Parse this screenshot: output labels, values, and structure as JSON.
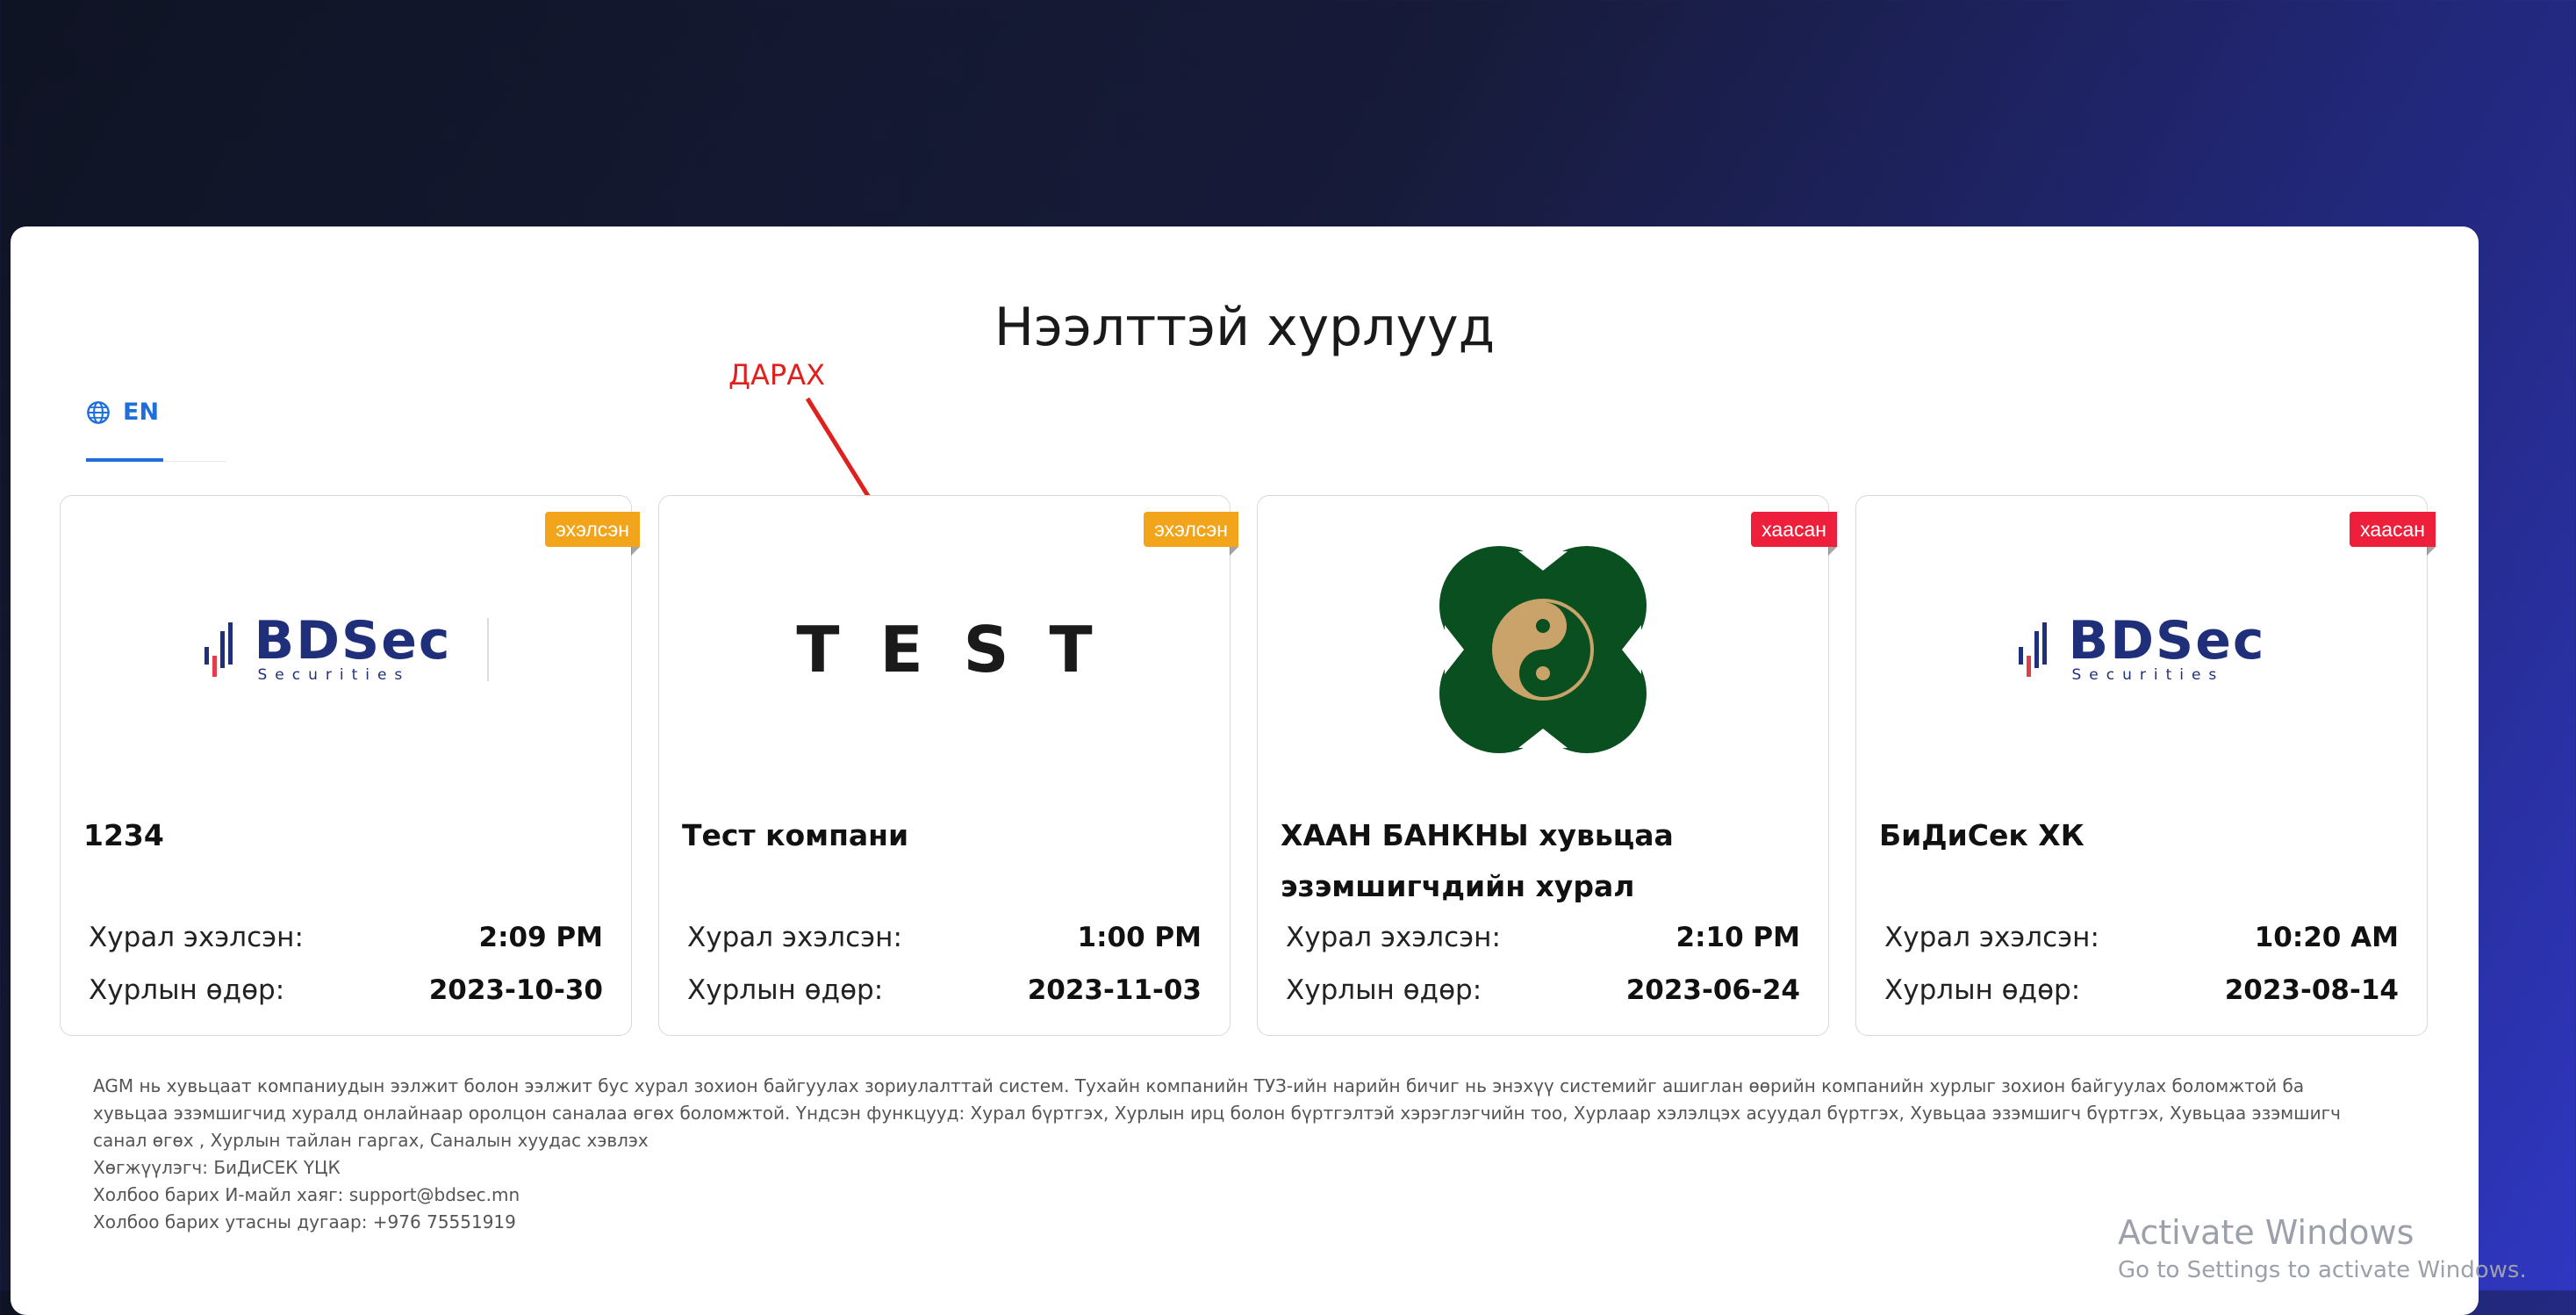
{
  "page": {
    "title": "Нээлттэй хурлууд"
  },
  "language_tab": {
    "label": "EN"
  },
  "annotation": {
    "label": "ДАРАХ",
    "color": "#e0201c"
  },
  "meetings": [
    {
      "status": "эхэлсэн",
      "status_color": "#f2a41a",
      "logo": "BDSec Securities logo",
      "logo_main": "BDSec",
      "logo_sub": "Securities",
      "company": "1234",
      "start_label": "Хурал эхэлсэн:",
      "start_time": "2:09 PM",
      "date_label": "Хурлын өдөр:",
      "date": "2023-10-30"
    },
    {
      "status": "эхэлсэн",
      "status_color": "#f2a41a",
      "logo": "TEST logo",
      "logo_text": "TEST",
      "company": "Тест компани",
      "start_label": "Хурал эхэлсэн:",
      "start_time": "1:00 PM",
      "date_label": "Хурлын өдөр:",
      "date": "2023-11-03"
    },
    {
      "status": "хаасан",
      "status_color": "#ee1f3a",
      "logo": "Khan Bank logo",
      "company": "ХААН БАНКНЫ хувьцаа эзэмшигчдийн хурал",
      "start_label": "Хурал эхэлсэн:",
      "start_time": "2:10 PM",
      "date_label": "Хурлын өдөр:",
      "date": "2023-06-24"
    },
    {
      "status": "хаасан",
      "status_color": "#ee1f3a",
      "logo": "BDSec Securities logo",
      "logo_main": "BDSec",
      "logo_sub": "Securities",
      "company": "БиДиСек ХК",
      "start_label": "Хурал эхэлсэн:",
      "start_time": "10:20 AM",
      "date_label": "Хурлын өдөр:",
      "date": "2023-08-14"
    }
  ],
  "footer": {
    "description": "AGM нь хувьцаат компаниудын ээлжит болон ээлжит бус хурал зохион байгуулах зориулалттай систем. Тухайн компанийн ТУЗ-ийн нарийн бичиг нь энэхүү системийг ашиглан өөрийн компанийн хурлыг зохион байгуулах боломжтой ба хувьцаа эзэмшигчид хуралд онлайнаар оролцон саналаа өгөх боломжтой. Үндсэн функцууд: Хурал бүртгэх, Хурлын ирц болон бүртгэлтэй хэрэглэгчийн тоо, Хурлаар хэлэлцэх асуудал бүртгэх, Хувьцаа эзэмшигч бүртгэх, Хувьцаа эзэмшигч санал өгөх , Хурлын тайлан гаргах, Саналын хуудас хэвлэх",
    "developer": "Хөгжүүлэгч: БиДиСЕК ҮЦК",
    "email": "Холбоо барих И-майл хаяг: support@bdsec.mn",
    "phone": "Холбоо барих утасны дугаар: +976 75551919"
  },
  "watermark": {
    "line1": "Activate Windows",
    "line2": "Go to Settings to activate Windows."
  }
}
